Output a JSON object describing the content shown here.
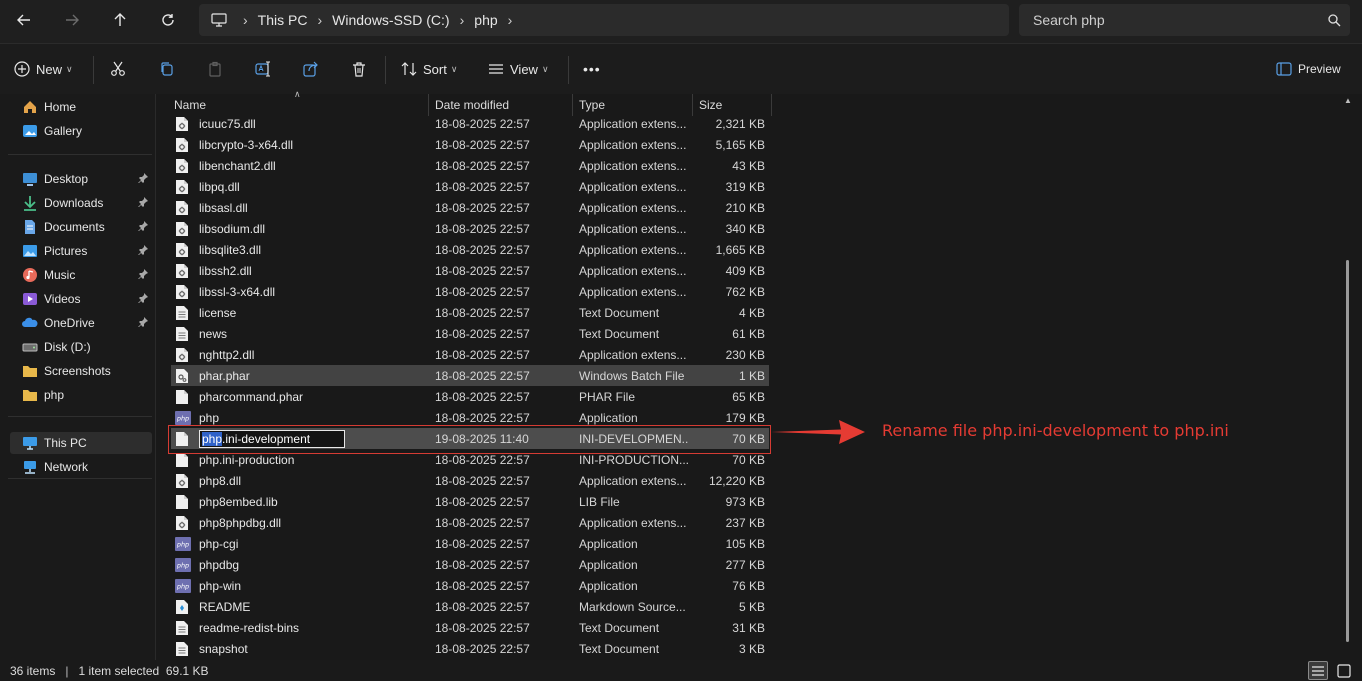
{
  "topbar": {
    "breadcrumbs": [
      "This PC",
      "Windows-SSD (C:)",
      "php"
    ],
    "search_placeholder": "Search php"
  },
  "toolbar": {
    "new_label": "New",
    "sort_label": "Sort",
    "view_label": "View",
    "more_label": "•••",
    "preview_label": "Preview"
  },
  "sidebar": {
    "items": [
      {
        "label": "Home",
        "icon": "home-icon",
        "color": "#e3a34a"
      },
      {
        "label": "Gallery",
        "icon": "gallery-icon",
        "color": "#3b9be8"
      },
      {
        "label": "Desktop",
        "icon": "desktop-icon",
        "color": "#3d8fd6"
      },
      {
        "label": "Downloads",
        "icon": "downloads-icon",
        "color": "#4bbf8a"
      },
      {
        "label": "Documents",
        "icon": "documents-icon",
        "color": "#6aa7e8"
      },
      {
        "label": "Pictures",
        "icon": "pictures-icon",
        "color": "#3b9be8"
      },
      {
        "label": "Music",
        "icon": "music-icon",
        "color": "#e86a5a"
      },
      {
        "label": "Videos",
        "icon": "videos-icon",
        "color": "#8a5ad6"
      },
      {
        "label": "OneDrive",
        "icon": "onedrive-icon",
        "color": "#3b8fe8"
      },
      {
        "label": "Disk (D:)",
        "icon": "disk-icon",
        "color": "#bdbdbd"
      },
      {
        "label": "Screenshots",
        "icon": "folder-icon",
        "color": "#e8b84a"
      },
      {
        "label": "php",
        "icon": "folder-icon",
        "color": "#e8b84a"
      },
      {
        "label": "This PC",
        "icon": "this-pc-icon",
        "color": "#3b9be8"
      },
      {
        "label": "Network",
        "icon": "network-icon",
        "color": "#3b9be8"
      }
    ]
  },
  "columns": {
    "name": "Name",
    "date": "Date modified",
    "type": "Type",
    "size": "Size"
  },
  "files": [
    {
      "name": "icuuc75.dll",
      "date": "18-08-2025 22:57",
      "type": "Application extens...",
      "size": "2,321 KB",
      "icon": "dll"
    },
    {
      "name": "libcrypto-3-x64.dll",
      "date": "18-08-2025 22:57",
      "type": "Application extens...",
      "size": "5,165 KB",
      "icon": "dll"
    },
    {
      "name": "libenchant2.dll",
      "date": "18-08-2025 22:57",
      "type": "Application extens...",
      "size": "43 KB",
      "icon": "dll"
    },
    {
      "name": "libpq.dll",
      "date": "18-08-2025 22:57",
      "type": "Application extens...",
      "size": "319 KB",
      "icon": "dll"
    },
    {
      "name": "libsasl.dll",
      "date": "18-08-2025 22:57",
      "type": "Application extens...",
      "size": "210 KB",
      "icon": "dll"
    },
    {
      "name": "libsodium.dll",
      "date": "18-08-2025 22:57",
      "type": "Application extens...",
      "size": "340 KB",
      "icon": "dll"
    },
    {
      "name": "libsqlite3.dll",
      "date": "18-08-2025 22:57",
      "type": "Application extens...",
      "size": "1,665 KB",
      "icon": "dll"
    },
    {
      "name": "libssh2.dll",
      "date": "18-08-2025 22:57",
      "type": "Application extens...",
      "size": "409 KB",
      "icon": "dll"
    },
    {
      "name": "libssl-3-x64.dll",
      "date": "18-08-2025 22:57",
      "type": "Application extens...",
      "size": "762 KB",
      "icon": "dll"
    },
    {
      "name": "license",
      "date": "18-08-2025 22:57",
      "type": "Text Document",
      "size": "4 KB",
      "icon": "txt"
    },
    {
      "name": "news",
      "date": "18-08-2025 22:57",
      "type": "Text Document",
      "size": "61 KB",
      "icon": "txt"
    },
    {
      "name": "nghttp2.dll",
      "date": "18-08-2025 22:57",
      "type": "Application extens...",
      "size": "230 KB",
      "icon": "dll"
    },
    {
      "name": "phar.phar",
      "date": "18-08-2025 22:57",
      "type": "Windows Batch File",
      "size": "1 KB",
      "icon": "bat"
    },
    {
      "name": "pharcommand.phar",
      "date": "18-08-2025 22:57",
      "type": "PHAR File",
      "size": "65 KB",
      "icon": "blank"
    },
    {
      "name": "php",
      "date": "18-08-2025 22:57",
      "type": "Application",
      "size": "179 KB",
      "icon": "php"
    },
    {
      "name": "php.ini-development",
      "date": "19-08-2025 11:40",
      "type": "INI-DEVELOPMEN...",
      "size": "70 KB",
      "icon": "blank",
      "rename_selected": "php",
      "rename_rest": ".ini-development"
    },
    {
      "name": "php.ini-production",
      "date": "18-08-2025 22:57",
      "type": "INI-PRODUCTION...",
      "size": "70 KB",
      "icon": "blank"
    },
    {
      "name": "php8.dll",
      "date": "18-08-2025 22:57",
      "type": "Application extens...",
      "size": "12,220 KB",
      "icon": "dll"
    },
    {
      "name": "php8embed.lib",
      "date": "18-08-2025 22:57",
      "type": "LIB File",
      "size": "973 KB",
      "icon": "blank"
    },
    {
      "name": "php8phpdbg.dll",
      "date": "18-08-2025 22:57",
      "type": "Application extens...",
      "size": "237 KB",
      "icon": "dll"
    },
    {
      "name": "php-cgi",
      "date": "18-08-2025 22:57",
      "type": "Application",
      "size": "105 KB",
      "icon": "php"
    },
    {
      "name": "phpdbg",
      "date": "18-08-2025 22:57",
      "type": "Application",
      "size": "277 KB",
      "icon": "php"
    },
    {
      "name": "php-win",
      "date": "18-08-2025 22:57",
      "type": "Application",
      "size": "76 KB",
      "icon": "php"
    },
    {
      "name": "README",
      "date": "18-08-2025 22:57",
      "type": "Markdown Source...",
      "size": "5 KB",
      "icon": "md"
    },
    {
      "name": "readme-redist-bins",
      "date": "18-08-2025 22:57",
      "type": "Text Document",
      "size": "31 KB",
      "icon": "txt"
    },
    {
      "name": "snapshot",
      "date": "18-08-2025 22:57",
      "type": "Text Document",
      "size": "3 KB",
      "icon": "txt"
    }
  ],
  "annotation": {
    "text": "Rename file php.ini-development to php.ini",
    "color": "#e53b33"
  },
  "status": {
    "count": "36 items",
    "selection": "1 item selected  69.1 KB"
  }
}
